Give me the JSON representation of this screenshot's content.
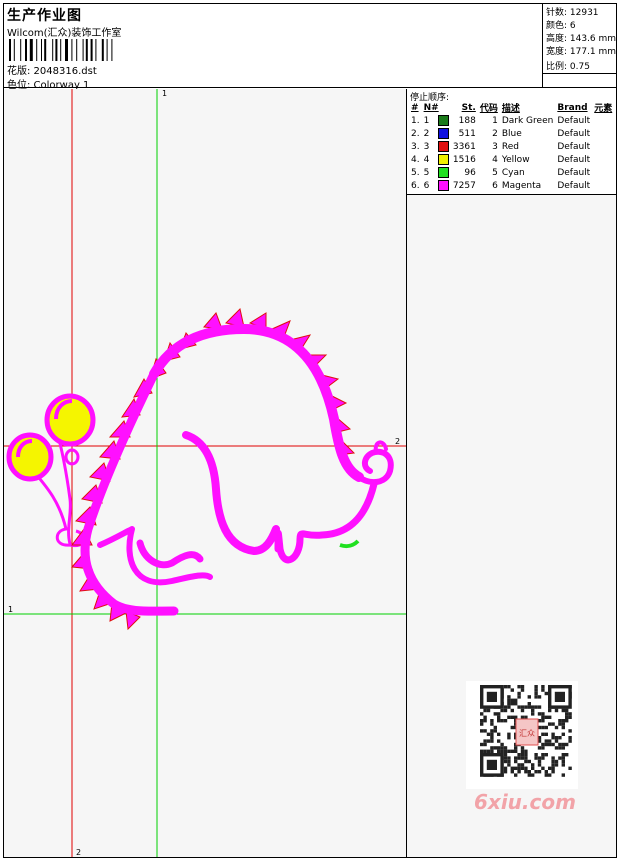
{
  "header": {
    "title": "生产作业图",
    "company": "Wilcom(汇众)装饰工作室",
    "design_label": "花版: 2048316.dst",
    "colorway_label": "色位: Colorway 1"
  },
  "stats": {
    "stitches": "针数: 12931",
    "colors": "颜色: 6",
    "height": "高度: 143.6 mm",
    "width": "宽度: 177.1 mm",
    "scale": "比例: 0.75"
  },
  "sequence": {
    "heading": "停止顺序:",
    "columns": [
      "#",
      "N#",
      "St.",
      "代码",
      "描述",
      "Brand",
      "元素"
    ],
    "rows": [
      {
        "idx": "1.",
        "n": "1",
        "color": "#1a7a1a",
        "st": "188",
        "code": "1",
        "desc": "Dark Green",
        "brand": "Default"
      },
      {
        "idx": "2.",
        "n": "2",
        "color": "#1010e0",
        "st": "511",
        "code": "2",
        "desc": "Blue",
        "brand": "Default"
      },
      {
        "idx": "3.",
        "n": "3",
        "color": "#e01010",
        "st": "3361",
        "code": "3",
        "desc": "Red",
        "brand": "Default"
      },
      {
        "idx": "4.",
        "n": "4",
        "color": "#f0f000",
        "st": "1516",
        "code": "4",
        "desc": "Yellow",
        "brand": "Default"
      },
      {
        "idx": "5.",
        "n": "5",
        "color": "#20e020",
        "st": "96",
        "code": "5",
        "desc": "Cyan",
        "brand": "Default"
      },
      {
        "idx": "6.",
        "n": "6",
        "color": "#ff10ff",
        "st": "7257",
        "code": "6",
        "desc": "Magenta",
        "brand": "Default"
      }
    ]
  },
  "guides": {
    "green_v_label": "1",
    "green_h_label": "1",
    "red_v_label": "2",
    "red_h_label": "2"
  },
  "watermark": {
    "seal_text": "汇众",
    "site": "6xiu.com"
  }
}
